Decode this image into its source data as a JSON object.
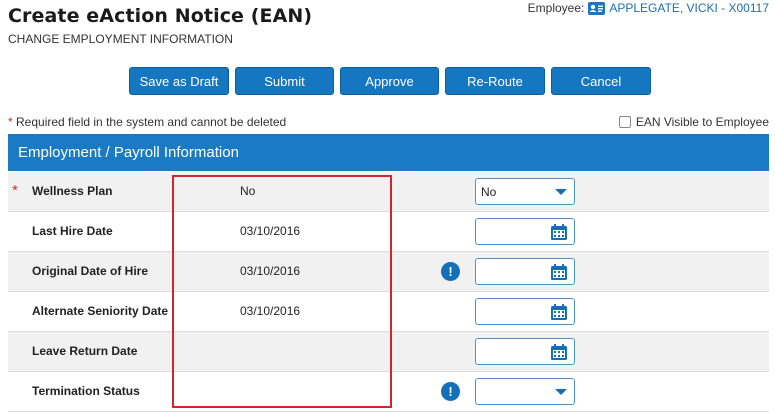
{
  "header": {
    "title": "Create eAction Notice (EAN)",
    "subtitle": "CHANGE EMPLOYMENT INFORMATION",
    "employee_label": "Employee:",
    "employee_name": "APPLEGATE, VICKI - X00117"
  },
  "actions": {
    "save_draft": "Save as Draft",
    "submit": "Submit",
    "approve": "Approve",
    "reroute": "Re-Route",
    "cancel": "Cancel"
  },
  "notes": {
    "required_star": "*",
    "required_text": "Required field in the system and cannot be deleted",
    "visible_label": "EAN Visible to Employee"
  },
  "section": {
    "title": "Employment / Payroll Information"
  },
  "fields": {
    "wellness": {
      "star": "*",
      "label": "Wellness Plan",
      "value": "No",
      "select_value": "No"
    },
    "last_hire": {
      "label": "Last Hire Date",
      "value": "03/10/2016"
    },
    "original_hire": {
      "label": "Original Date of Hire",
      "value": "03/10/2016",
      "alert": "!"
    },
    "alt_seniority": {
      "label": "Alternate Seniority Date",
      "value": "03/10/2016"
    },
    "leave_return": {
      "label": "Leave Return Date",
      "value": ""
    },
    "termination": {
      "label": "Termination Status",
      "value": "",
      "alert": "!",
      "select_value": ""
    }
  },
  "colors": {
    "accent": "#1576c2",
    "header_bar": "#1a7bc4",
    "required": "#c8302c",
    "highlight": "#d3262c"
  },
  "icons": {
    "employee": "id-card-icon",
    "calendar": "calendar-icon",
    "alert": "exclamation-circle-icon",
    "dropdown": "caret-down-icon"
  }
}
